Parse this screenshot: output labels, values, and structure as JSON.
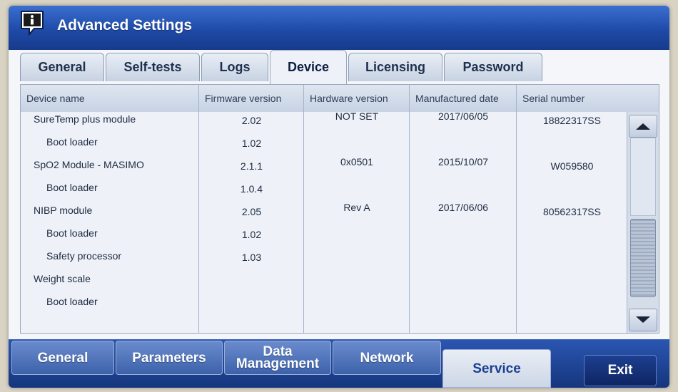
{
  "window": {
    "title": "Advanced Settings",
    "title_icon": "info-speech-bubble-icon"
  },
  "top_tabs": [
    {
      "label": "General"
    },
    {
      "label": "Self-tests"
    },
    {
      "label": "Logs"
    },
    {
      "label": "Device",
      "active": true
    },
    {
      "label": "Licensing"
    },
    {
      "label": "Password"
    }
  ],
  "table": {
    "columns": [
      "Device name",
      "Firmware version",
      "Hardware version",
      "Manufactured date",
      "Serial number"
    ],
    "rows": [
      {
        "name": "SureTemp plus module",
        "indent": false,
        "firmware": "2.02",
        "hardware": "NOT SET",
        "date": "2017/06/05",
        "serial": "18822317SS"
      },
      {
        "name": "Boot loader",
        "indent": true,
        "firmware": "1.02",
        "hardware": "",
        "date": "",
        "serial": ""
      },
      {
        "name": "SpO2 Module - MASIMO",
        "indent": false,
        "firmware": "2.1.1",
        "hardware": "0x0501",
        "date": "2015/10/07",
        "serial": "W059580"
      },
      {
        "name": "Boot loader",
        "indent": true,
        "firmware": "1.0.4",
        "hardware": "",
        "date": "",
        "serial": ""
      },
      {
        "name": "NIBP module",
        "indent": false,
        "firmware": "2.05",
        "hardware": "Rev A",
        "date": "2017/06/06",
        "serial": "80562317SS"
      },
      {
        "name": "Boot loader",
        "indent": true,
        "firmware": "1.02",
        "hardware": "",
        "date": "",
        "serial": ""
      },
      {
        "name": "Safety processor",
        "indent": true,
        "firmware": "1.03",
        "hardware": "",
        "date": "",
        "serial": ""
      },
      {
        "name": "Weight scale",
        "indent": false,
        "firmware": "",
        "hardware": "",
        "date": "",
        "serial": ""
      },
      {
        "name": "Boot loader",
        "indent": true,
        "firmware": "",
        "hardware": "",
        "date": "",
        "serial": ""
      }
    ]
  },
  "scrollbar": {
    "up_icon": "triangle-up-icon",
    "down_icon": "triangle-down-icon"
  },
  "bottom_tabs": [
    {
      "label": "General"
    },
    {
      "label": "Parameters"
    },
    {
      "label": "Data Management"
    },
    {
      "label": "Network"
    },
    {
      "label": "Service",
      "active": true
    }
  ],
  "exit_label": "Exit",
  "colors": {
    "title_bar": "#1f4aa8",
    "nav_bar": "#16367d",
    "panel": "#eef2f8"
  }
}
